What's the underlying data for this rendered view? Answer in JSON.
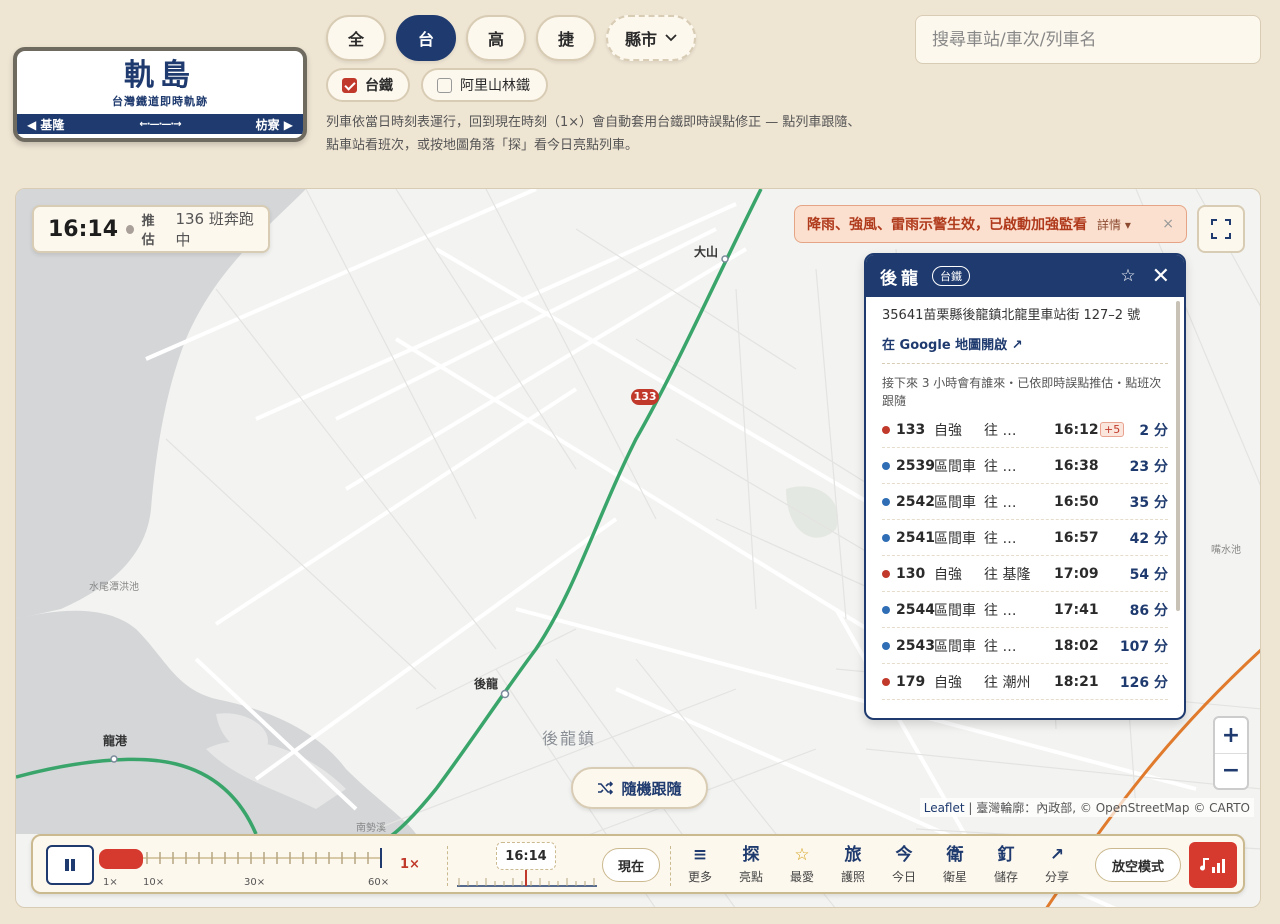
{
  "logo": {
    "title": "軌島",
    "subtitle": "台灣鐵道即時軌跡",
    "left": "◀ 基隆",
    "right": "枋寮 ▶"
  },
  "categories": [
    "全",
    "台",
    "高",
    "捷"
  ],
  "county": {
    "label": "縣市",
    "icon": "chevron-down-icon"
  },
  "filters": [
    {
      "label": "台鐵",
      "checked": true
    },
    {
      "label": "阿里山林鐵",
      "checked": false
    }
  ],
  "description": [
    "列車依當日時刻表運行，回到現在時刻（1×）會自動套用台鐵即時誤點修正 — 點列車跟隨、",
    "點車站看班次，或按地圖角落「探」看今日亮點列車。"
  ],
  "search": {
    "placeholder": "搜尋車站/車次/列車名"
  },
  "clock": {
    "time": "16:14",
    "estimate": "推估",
    "running": "136 班奔跑中"
  },
  "alert": {
    "text": "降雨、強風、雷雨示警生效，已啟動加強監看",
    "more": "詳情",
    "close": "×"
  },
  "map_labels": {
    "dashan": "大山",
    "houlong_station": "後龍",
    "longgang": "龍港",
    "houlong_town": "後龍鎮",
    "reservoir": "水尾潭洪池",
    "pool": "嘴水池",
    "nanshi": "南勢溪",
    "train_badge": "133"
  },
  "popup": {
    "name": "後龍",
    "tag": "台鐵",
    "address": "35641苗栗縣後龍鎮北龍里車站街 127–2 號",
    "gmap": "在 Google 地圖開啟 ↗",
    "note": "接下來 3 小時會有誰來・已依即時誤點推估・點班次跟隨",
    "rows": [
      {
        "no": "133",
        "type": "自強",
        "dest": "往 …",
        "time": "16:12",
        "delay": "+5",
        "min": "2 分",
        "color": "#c0392b"
      },
      {
        "no": "2539",
        "type": "區間車",
        "dest": "往 …",
        "time": "16:38",
        "delay": "",
        "min": "23 分",
        "color": "#2f6db5"
      },
      {
        "no": "2542",
        "type": "區間車",
        "dest": "往 …",
        "time": "16:50",
        "delay": "",
        "min": "35 分",
        "color": "#2f6db5"
      },
      {
        "no": "2541",
        "type": "區間車",
        "dest": "往 …",
        "time": "16:57",
        "delay": "",
        "min": "42 分",
        "color": "#2f6db5"
      },
      {
        "no": "130",
        "type": "自強",
        "dest": "往 基隆",
        "time": "17:09",
        "delay": "",
        "min": "54 分",
        "color": "#c0392b"
      },
      {
        "no": "2544",
        "type": "區間車",
        "dest": "往 …",
        "time": "17:41",
        "delay": "",
        "min": "86 分",
        "color": "#2f6db5"
      },
      {
        "no": "2543",
        "type": "區間車",
        "dest": "往 …",
        "time": "18:02",
        "delay": "",
        "min": "107 分",
        "color": "#2f6db5"
      },
      {
        "no": "179",
        "type": "自強",
        "dest": "往 潮州",
        "time": "18:21",
        "delay": "",
        "min": "126 分",
        "color": "#c0392b"
      }
    ]
  },
  "random_follow": "隨機跟隨",
  "attribution": {
    "leaflet": "Leaflet",
    "rest": " | 臺灣輪廓：內政部, © OpenStreetMap © CARTO"
  },
  "controls": {
    "speed_ticks": [
      "1×",
      "10×",
      "30×",
      "60×"
    ],
    "speed_value": "1×",
    "time": "16:14",
    "now": "現在",
    "tools": [
      {
        "glyph": "≡",
        "label": "更多"
      },
      {
        "glyph": "探",
        "label": "亮點"
      },
      {
        "glyph": "☆",
        "label": "最愛"
      },
      {
        "glyph": "旅",
        "label": "護照"
      },
      {
        "glyph": "今",
        "label": "今日"
      },
      {
        "glyph": "衛",
        "label": "衛星"
      },
      {
        "glyph": "釘",
        "label": "儲存"
      },
      {
        "glyph": "↗",
        "label": "分享"
      }
    ],
    "fly": "放空模式"
  },
  "colors": {
    "brand": "#1e3a6e",
    "accent": "#c0392b",
    "rail": "#3aa56a",
    "hsr": "#e07b2e"
  }
}
